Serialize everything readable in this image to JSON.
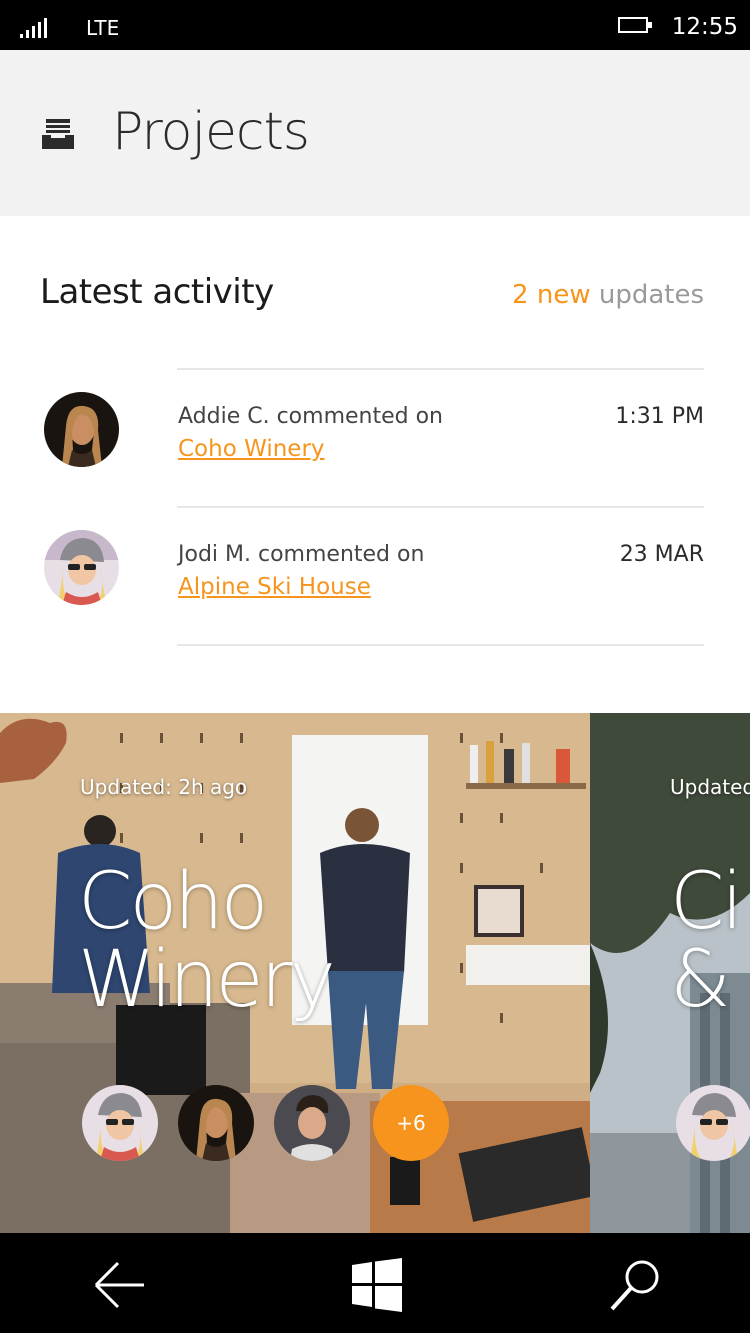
{
  "status_bar": {
    "network": "LTE",
    "time": "12:55"
  },
  "header": {
    "title": "Projects",
    "icon": "inbox-tray-icon"
  },
  "activity": {
    "title": "Latest activity",
    "updates_new": "2 new",
    "updates_suffix": " updates",
    "items": [
      {
        "text": "Addie C. commented on",
        "link": "Coho Winery",
        "time": "1:31 PM"
      },
      {
        "text": "Jodi M. commented on",
        "link": "Alpine Ski House",
        "time": "23 MAR"
      }
    ]
  },
  "cards": [
    {
      "updated": "Updated: 2h ago",
      "title_line1": "Coho",
      "title_line2": "Winery",
      "more": "+6"
    },
    {
      "updated": "Updated",
      "title_line1": "Ci",
      "title_line2": "& "
    }
  ],
  "nav": {
    "back": "back-arrow-icon",
    "home": "windows-logo-icon",
    "search": "search-icon"
  },
  "colors": {
    "accent": "#f7941d",
    "header_bg": "#f2f2f2"
  }
}
